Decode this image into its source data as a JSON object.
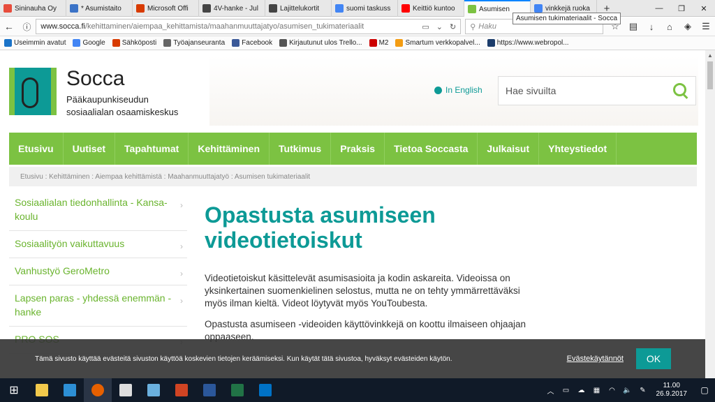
{
  "browser": {
    "tabs": [
      {
        "label": "Sininauha Oy",
        "color": "#e74c3c",
        "active": false
      },
      {
        "label": "* Asumistaito",
        "color": "#3b73c7",
        "active": false
      },
      {
        "label": "Microsoft Offi",
        "color": "#d83b01",
        "active": false
      },
      {
        "label": "4V-hanke - Jul",
        "color": "#444444",
        "active": false
      },
      {
        "label": "Lajittelukortit",
        "color": "#444444",
        "active": false
      },
      {
        "label": "suomi taskuss",
        "color": "#4285f4",
        "active": false
      },
      {
        "label": "Keittiö kuntoo",
        "color": "#ff0000",
        "active": false
      },
      {
        "label": "Asumisen",
        "color": "#7cc242",
        "active": true
      },
      {
        "label": "vinkkejä ruoka",
        "color": "#4285f4",
        "active": false
      }
    ],
    "tooltip": "Asumisen tukimateriaalit - Socca",
    "url_host": "www.socca.fi",
    "url_path": "/kehittaminen/aiempaa_kehittamista/maahanmuuttajatyo/asumisen_tukimateriaalit",
    "search_placeholder": "Haku",
    "bookmarks": [
      {
        "label": "Useimmin avatut",
        "color": "#1a73c8"
      },
      {
        "label": "Google",
        "color": "#4285f4"
      },
      {
        "label": "Sähköposti",
        "color": "#d83b01"
      },
      {
        "label": "Työajanseuranta",
        "color": "#666666"
      },
      {
        "label": "Facebook",
        "color": "#3b5998"
      },
      {
        "label": "Kirjautunut ulos Trello...",
        "color": "#555555"
      },
      {
        "label": "M2",
        "color": "#cc0000"
      },
      {
        "label": "Smartum verkkopalvel...",
        "color": "#f39c12"
      },
      {
        "label": "https://www.webropol...",
        "color": "#1b3c6b"
      }
    ]
  },
  "site": {
    "brand": "Socca",
    "subtitle_line1": "Pääkaupunkiseudun",
    "subtitle_line2": "sosiaalialan osaamiskeskus",
    "lang_link": "In English",
    "search_placeholder": "Hae sivuilta",
    "nav": [
      "Etusivu",
      "Uutiset",
      "Tapahtumat",
      "Kehittäminen",
      "Tutkimus",
      "Praksis",
      "Tietoa Soccasta",
      "Julkaisut",
      "Yhteystiedot"
    ],
    "breadcrumb": "Etusivu : Kehittäminen : Aiempaa kehittämistä : Maahanmuuttajatyö : Asumisen tukimateriaalit",
    "sidebar": [
      "Sosiaalialan tiedonhallinta - Kansa-koulu",
      "Sosiaalityön vaikuttavuus",
      "Vanhustyö GeroMetro",
      "Lapsen paras - yhdessä enemmän -hanke",
      "PRO SOS"
    ],
    "heading": "Opastusta asumiseen videotietoiskut",
    "paragraph1": "Videotietoiskut käsittelevät asumisasioita ja kodin askareita. Videoissa on yksinkertainen suomenkielinen selostus, mutta ne on tehty ymmärrettäväksi myös ilman kieltä. Videot löytyvät myös YouToubesta.",
    "paragraph2": "Opastusta asumiseen -videoiden käyttövinkkejä on koottu ilmaiseen ohjaajan oppaaseen."
  },
  "cookie": {
    "text": "Tämä sivusto käyttää evästeitä sivuston käyttöä koskevien tietojen keräämiseksi. Kun käytät tätä sivustoa, hyväksyt evästeiden käytön.",
    "link": "Evästekäytännöt",
    "ok": "OK"
  },
  "taskbar": {
    "apps": [
      {
        "name": "file-explorer",
        "color": "#f2c94c"
      },
      {
        "name": "internet-explorer",
        "color": "#2d8fd5"
      },
      {
        "name": "firefox",
        "color": "#e66000"
      },
      {
        "name": "calendar",
        "color": "#dddddd"
      },
      {
        "name": "notes",
        "color": "#6ab0de"
      },
      {
        "name": "powerpoint",
        "color": "#d04423"
      },
      {
        "name": "word",
        "color": "#2b579a"
      },
      {
        "name": "excel",
        "color": "#217346"
      },
      {
        "name": "outlook",
        "color": "#0072c6"
      }
    ],
    "time": "11.00",
    "date": "26.9.2017"
  }
}
